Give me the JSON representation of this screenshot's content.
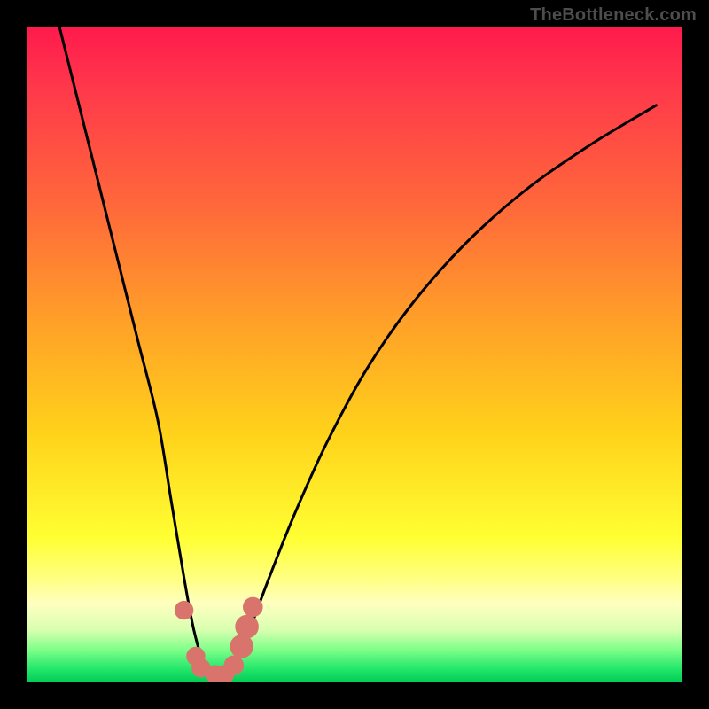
{
  "watermark": "TheBottleneck.com",
  "chart_data": {
    "type": "line",
    "title": "",
    "xlabel": "",
    "ylabel": "",
    "xlim": [
      0,
      100
    ],
    "ylim": [
      0,
      100
    ],
    "series": [
      {
        "name": "bottleneck-curve",
        "x": [
          5,
          8,
          11,
          14,
          17,
          20,
          22,
          24,
          25.5,
          27,
          28.5,
          30,
          32,
          34,
          37,
          41,
          46,
          52,
          59,
          67,
          76,
          86,
          96
        ],
        "y": [
          100,
          88,
          76,
          64,
          52,
          40,
          28,
          16,
          8,
          3,
          1,
          1,
          3,
          8,
          16,
          26,
          37,
          48,
          58,
          67,
          75,
          82,
          88
        ]
      }
    ],
    "markers": [
      {
        "x": 24.0,
        "y": 11.0,
        "r": 1.0
      },
      {
        "x": 25.8,
        "y": 4.0,
        "r": 1.0
      },
      {
        "x": 26.6,
        "y": 2.2,
        "r": 1.0
      },
      {
        "x": 28.8,
        "y": 1.2,
        "r": 1.0
      },
      {
        "x": 30.2,
        "y": 1.2,
        "r": 1.0
      },
      {
        "x": 31.6,
        "y": 2.6,
        "r": 1.1
      },
      {
        "x": 32.8,
        "y": 5.5,
        "r": 1.4
      },
      {
        "x": 33.6,
        "y": 8.5,
        "r": 1.4
      },
      {
        "x": 34.5,
        "y": 11.5,
        "r": 1.1
      }
    ],
    "colors": {
      "curve": "#000000",
      "marker": "#d9746c"
    }
  }
}
